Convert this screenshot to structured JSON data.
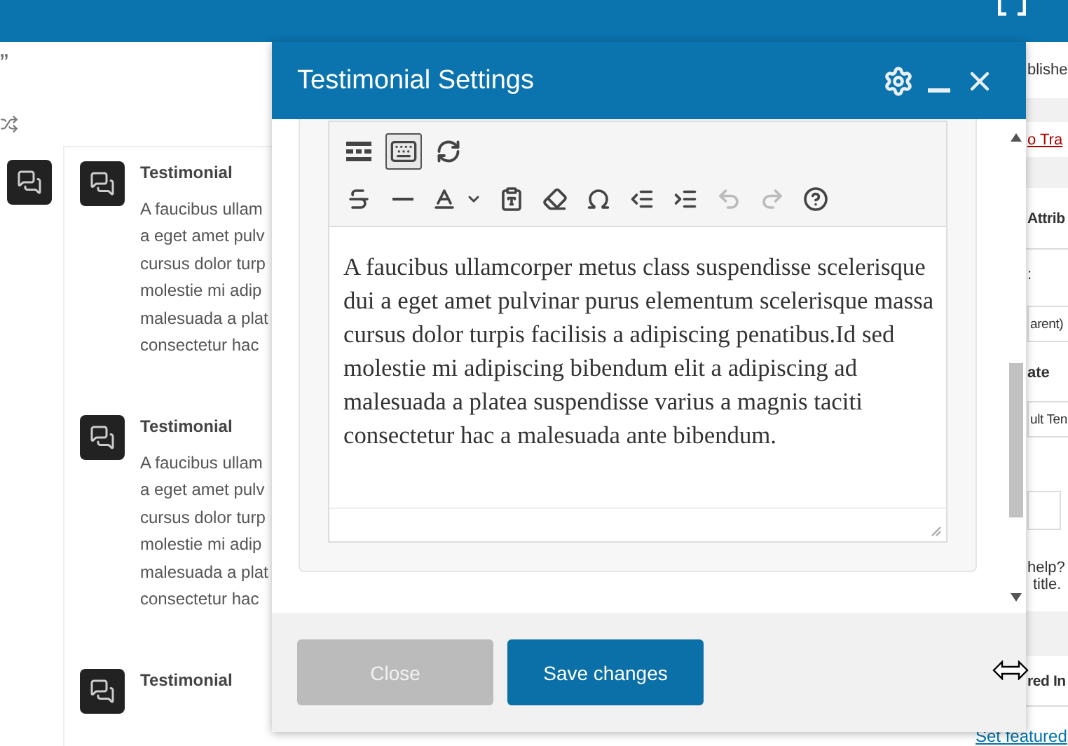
{
  "background_page": {
    "quote_mark": "”",
    "testimonials": [
      {
        "title": "Testimonial",
        "lines": [
          "A faucibus ullam",
          "a eget amet pulv",
          "cursus dolor turp",
          "molestie mi adip",
          "malesuada a plat",
          "consectetur hac"
        ]
      },
      {
        "title": "Testimonial",
        "lines": [
          "A faucibus ullam",
          "a eget amet pulv",
          "cursus dolor turp",
          "molestie mi adip",
          "malesuada a plat",
          "consectetur hac"
        ]
      },
      {
        "title": "Testimonial"
      }
    ],
    "sidebar": {
      "publish_status": "blishe",
      "trash_link": "o Tra",
      "attributes_heading": "Attrib",
      "parent_label": ":",
      "parent_select": "arent)",
      "template_label": "ate",
      "template_select": "ult Ten",
      "help_lines": [
        "help?",
        "title."
      ],
      "featured_heading": "red In",
      "featured_link": "Set featured"
    }
  },
  "modal": {
    "title": "Testimonial Settings",
    "editor": {
      "toolbar": {
        "row_1": [
          {
            "pressed": false
          },
          {
            "pressed": true
          },
          {
            "pressed": false
          }
        ],
        "row_2": [
          {
            "disabled": false
          },
          {
            "disabled": false
          },
          {
            "disabled": false
          },
          {
            "disabled": false
          },
          {
            "disabled": false
          },
          {
            "disabled": false
          },
          {
            "disabled": false
          },
          {
            "disabled": false
          },
          {
            "disabled": true
          },
          {
            "disabled": true
          },
          {
            "disabled": false
          }
        ]
      },
      "content": "A faucibus ullamcorper metus class suspendisse scelerisque dui a eget amet pulvinar purus elementum scelerisque massa cursus dolor turpis facilisis a adipiscing penatibus.Id sed molestie mi adipiscing bibendum elit a adipiscing ad malesuada a platea suspendisse varius a magnis taciti consectetur hac a malesuada ante bibendum."
    },
    "buttons": [
      {
        "label": "Close",
        "kind": "secondary"
      },
      {
        "label": "Save changes",
        "kind": "primary"
      }
    ]
  }
}
